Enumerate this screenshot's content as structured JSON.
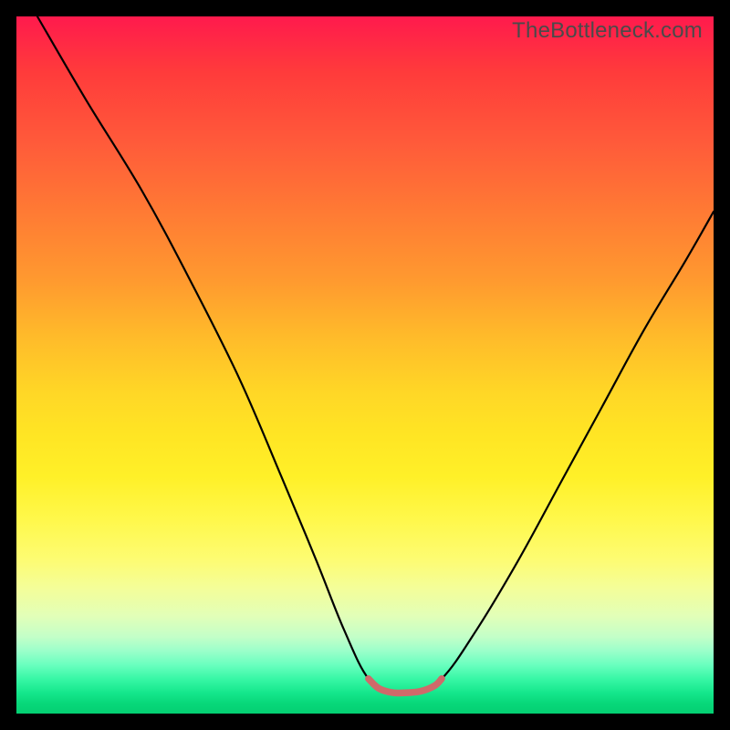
{
  "watermark": "TheBottleneck.com",
  "chart_data": {
    "type": "line",
    "title": "",
    "xlabel": "",
    "ylabel": "",
    "xlim": [
      0,
      100
    ],
    "ylim": [
      0,
      100
    ],
    "background_gradient": {
      "top_color": "#ff1a4d",
      "bottom_color": "#04cf72",
      "stops_note": "red at top → orange → yellow → yellow-green → green at bottom"
    },
    "series": [
      {
        "name": "bottleneck-curve",
        "color": "#000000",
        "x": [
          3,
          10,
          18,
          25,
          32,
          38,
          43,
          47,
          50.5,
          54,
          57,
          61,
          66,
          72,
          78,
          84,
          90,
          96,
          100
        ],
        "y": [
          100,
          88,
          75,
          62,
          48,
          34,
          22,
          12,
          5,
          3,
          3,
          5,
          12,
          22,
          33,
          44,
          55,
          65,
          72
        ]
      },
      {
        "name": "optimal-band",
        "color": "#cf6a6a",
        "x": [
          50.5,
          52,
          54,
          56,
          58,
          60,
          61
        ],
        "y": [
          5,
          3.6,
          3,
          3,
          3.2,
          4,
          5
        ]
      }
    ],
    "annotations": []
  }
}
